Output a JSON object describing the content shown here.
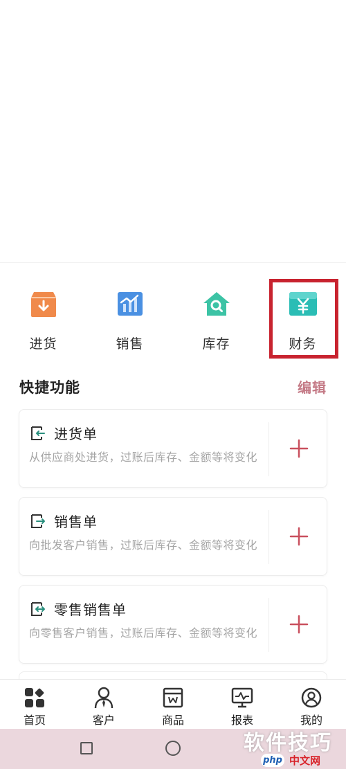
{
  "modules": [
    {
      "label": "进货",
      "icon": "purchase-box-icon",
      "color": "#f08a4b"
    },
    {
      "label": "销售",
      "icon": "sales-chart-icon",
      "color": "#4a90e2"
    },
    {
      "label": "库存",
      "icon": "inventory-house-icon",
      "color": "#3cc3a5"
    },
    {
      "label": "财务",
      "icon": "finance-wallet-icon",
      "color": "#2bbdb5"
    }
  ],
  "quick": {
    "title": "快捷功能",
    "edit": "编辑"
  },
  "cards": [
    {
      "title": "进货单",
      "desc": "从供应商处进货，过账后库存、金额等将变化",
      "icon": "purchase-doc-icon"
    },
    {
      "title": "销售单",
      "desc": "向批发客户销售，过账后库存、金额等将变化",
      "icon": "sales-doc-icon"
    },
    {
      "title": "零售销售单",
      "desc": "向零售客户销售，过账后库存、金额等将变化",
      "icon": "retail-doc-icon"
    }
  ],
  "tabs": [
    {
      "label": "首页",
      "icon": "home-grid-icon"
    },
    {
      "label": "客户",
      "icon": "customer-icon"
    },
    {
      "label": "商品",
      "icon": "goods-icon"
    },
    {
      "label": "报表",
      "icon": "report-icon"
    },
    {
      "label": "我的",
      "icon": "profile-icon"
    }
  ],
  "watermark": {
    "text": "软件技巧",
    "badge": "php",
    "site": "中文网"
  },
  "colors": {
    "accent": "#c8232f",
    "edit": "#c47a86",
    "plus": "#c9505e",
    "doc": "#2a8f7e"
  }
}
